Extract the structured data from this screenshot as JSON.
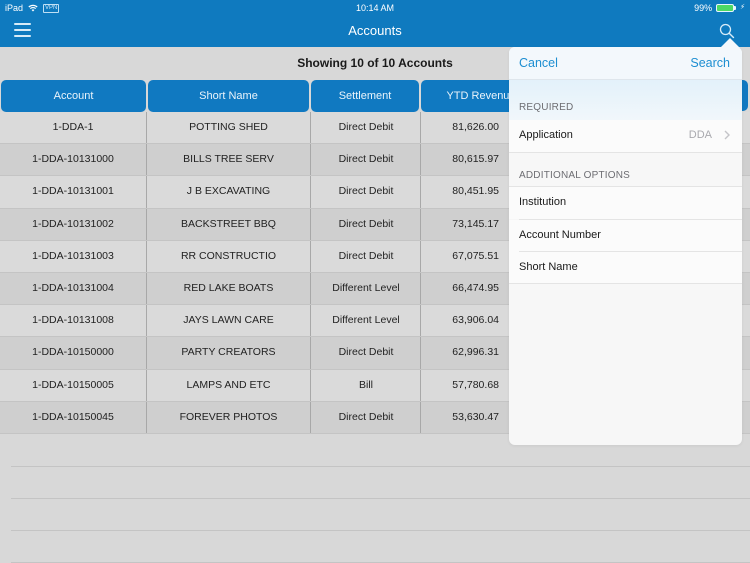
{
  "status_bar": {
    "device": "iPad",
    "vpn_label": "VPN",
    "time": "10:14 AM",
    "battery_percent": "99%",
    "battery_level": 0.99
  },
  "nav": {
    "title": "Accounts",
    "menu_icon": "hamburger-menu-icon",
    "search_icon": "search-icon"
  },
  "summary": "Showing 10 of 10 Accounts",
  "table": {
    "columns": [
      "Account",
      "Short Name",
      "Settlement",
      "YTD Revenue"
    ],
    "rows": [
      {
        "account": "1-DDA-1",
        "short_name": "POTTING SHED",
        "settlement": "Direct Debit",
        "ytd_revenue": "81,626.00"
      },
      {
        "account": "1-DDA-10131000",
        "short_name": "BILLS TREE SERV",
        "settlement": "Direct Debit",
        "ytd_revenue": "80,615.97"
      },
      {
        "account": "1-DDA-10131001",
        "short_name": "J B EXCAVATING",
        "settlement": "Direct Debit",
        "ytd_revenue": "80,451.95"
      },
      {
        "account": "1-DDA-10131002",
        "short_name": "BACKSTREET BBQ",
        "settlement": "Direct Debit",
        "ytd_revenue": "73,145.17"
      },
      {
        "account": "1-DDA-10131003",
        "short_name": "RR CONSTRUCTIO",
        "settlement": "Direct Debit",
        "ytd_revenue": "67,075.51"
      },
      {
        "account": "1-DDA-10131004",
        "short_name": "RED LAKE BOATS",
        "settlement": "Different Level",
        "ytd_revenue": "66,474.95"
      },
      {
        "account": "1-DDA-10131008",
        "short_name": "JAYS LAWN CARE",
        "settlement": "Different Level",
        "ytd_revenue": "63,906.04"
      },
      {
        "account": "1-DDA-10150000",
        "short_name": "PARTY CREATORS",
        "settlement": "Direct Debit",
        "ytd_revenue": "62,996.31"
      },
      {
        "account": "1-DDA-10150005",
        "short_name": "LAMPS AND ETC",
        "settlement": "Bill",
        "ytd_revenue": "57,780.68"
      },
      {
        "account": "1-DDA-10150045",
        "short_name": "FOREVER PHOTOS",
        "settlement": "Direct Debit",
        "ytd_revenue": "53,630.47"
      }
    ]
  },
  "search_popover": {
    "cancel_label": "Cancel",
    "search_label": "Search",
    "required_section": {
      "title": "REQUIRED",
      "items": [
        {
          "label": "Application",
          "value": "DDA"
        }
      ]
    },
    "additional_section": {
      "title": "ADDITIONAL OPTIONS",
      "items": [
        {
          "label": "Institution"
        },
        {
          "label": "Account Number"
        },
        {
          "label": "Short Name"
        }
      ]
    }
  },
  "colors": {
    "brand_blue": "#0f7abf",
    "header_cell_blue": "#1079c1",
    "link_blue": "#1d8ed1",
    "battery_green": "#4cd964",
    "row_light": "#dadada",
    "row_dark": "#cfcfcf"
  }
}
